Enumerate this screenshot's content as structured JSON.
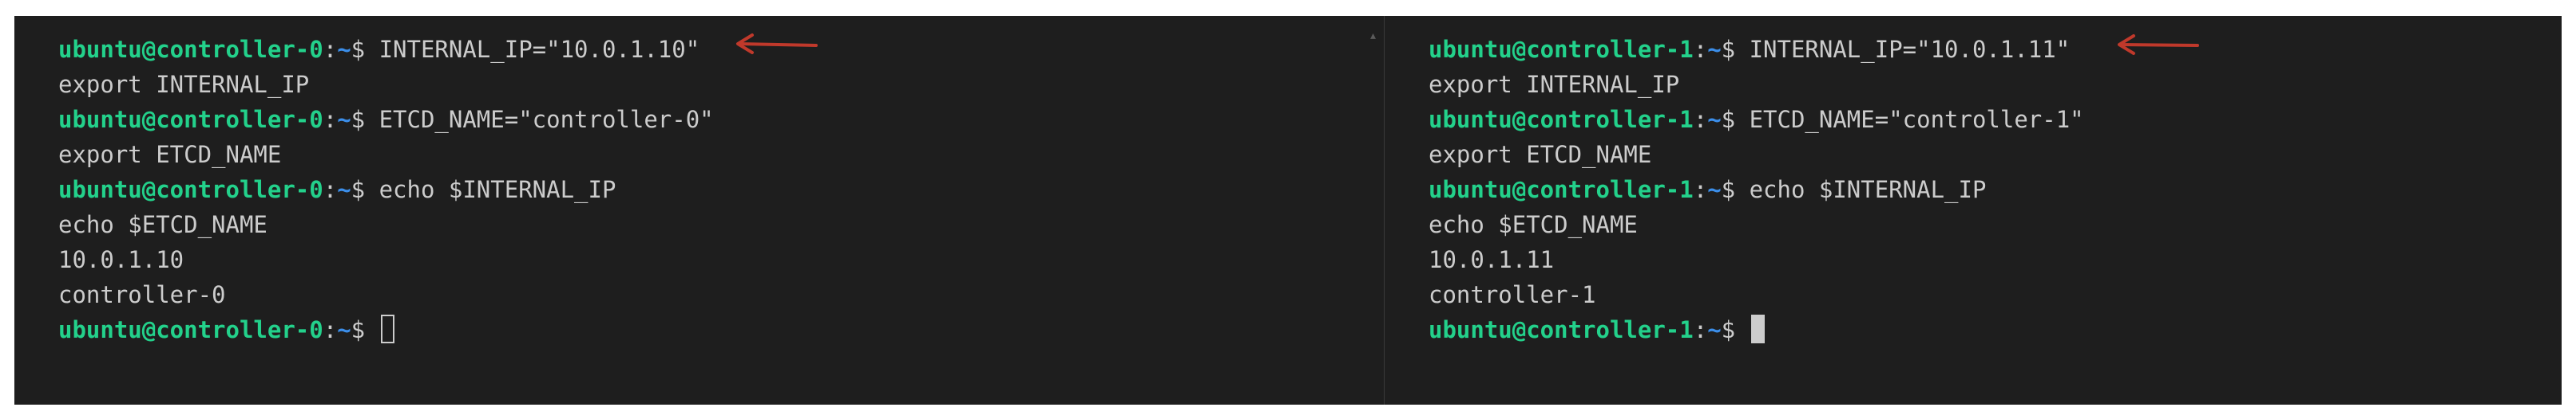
{
  "colors": {
    "background": "#1e1e1e",
    "prompt_user": "#23d18b",
    "prompt_path": "#3b8eea",
    "text": "#cccccc",
    "annotation_arrow": "#c0392b"
  },
  "panes": [
    {
      "host_prompt": {
        "user_host": "ubuntu@controller-0",
        "colon": ":",
        "path": "~",
        "dollar": "$ "
      },
      "lines": [
        {
          "cmd": "INTERNAL_IP=\"10.0.1.10\""
        },
        {
          "text": "export INTERNAL_IP"
        },
        {
          "cmd": "ETCD_NAME=\"controller-0\""
        },
        {
          "text": "export ETCD_NAME"
        },
        {
          "cmd": "echo $INTERNAL_IP"
        },
        {
          "text": "echo $ETCD_NAME"
        },
        {
          "text": "10.0.1.10"
        },
        {
          "text": "controller-0"
        }
      ],
      "cursor_style": "outline"
    },
    {
      "host_prompt": {
        "user_host": "ubuntu@controller-1",
        "colon": ":",
        "path": "~",
        "dollar": "$ "
      },
      "lines": [
        {
          "cmd": "INTERNAL_IP=\"10.0.1.11\""
        },
        {
          "text": "export INTERNAL_IP"
        },
        {
          "cmd": "ETCD_NAME=\"controller-1\""
        },
        {
          "text": "export ETCD_NAME"
        },
        {
          "cmd": "echo $INTERNAL_IP"
        },
        {
          "text": "echo $ETCD_NAME"
        },
        {
          "text": "10.0.1.11"
        },
        {
          "text": "controller-1"
        }
      ],
      "cursor_style": "block"
    }
  ],
  "icons": {
    "annotation": "red-arrow-icon",
    "scroll": "scroll-up-caret-icon"
  }
}
